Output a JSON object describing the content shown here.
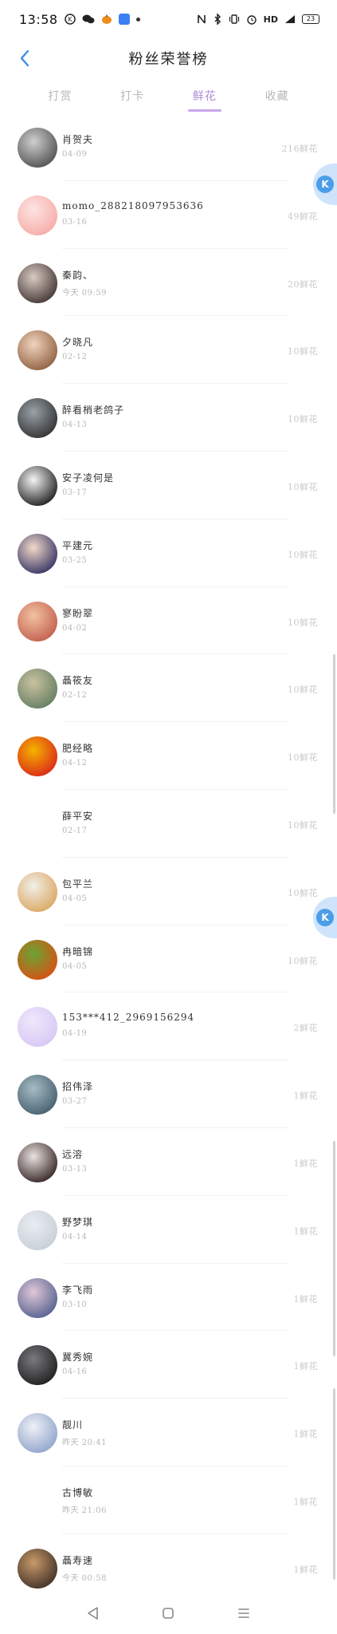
{
  "status_bar": {
    "time": "13:58",
    "battery": "23",
    "network": "HD"
  },
  "header": {
    "title": "粉丝荣誉榜",
    "back_icon": "chevron-left-icon"
  },
  "tabs": [
    {
      "label": "打赏",
      "active": false
    },
    {
      "label": "打卡",
      "active": false
    },
    {
      "label": "鲜花",
      "active": true
    },
    {
      "label": "收藏",
      "active": false
    }
  ],
  "ranking": [
    {
      "name": "肖贺夫",
      "date": "04-09",
      "value": "216鲜花",
      "avatar_colors": [
        "#4a4a4a",
        "#cfcfcf"
      ]
    },
    {
      "name": "momo_288218097953636",
      "date": "03-16",
      "value": "49鲜花",
      "avatar_colors": [
        "#f6a8a4",
        "#fde4e3"
      ]
    },
    {
      "name": "秦韵、",
      "date": "今天 09:59",
      "value": "20鲜花",
      "avatar_colors": [
        "#3a2d2a",
        "#d9cbc3"
      ]
    },
    {
      "name": "夕晓凡",
      "date": "02-12",
      "value": "10鲜花",
      "avatar_colors": [
        "#8a5a3a",
        "#f0d4bd"
      ]
    },
    {
      "name": "醉看梢老鸽子",
      "date": "04-13",
      "value": "10鲜花",
      "avatar_colors": [
        "#2b2b2b",
        "#9aa2a8"
      ]
    },
    {
      "name": "安子凌何是",
      "date": "03-17",
      "value": "10鲜花",
      "avatar_colors": [
        "#111111",
        "#f5f5f5"
      ]
    },
    {
      "name": "平建元",
      "date": "03-25",
      "value": "10鲜花",
      "avatar_colors": [
        "#2a2a5e",
        "#f2d9c8"
      ]
    },
    {
      "name": "寥盼翠",
      "date": "04-02",
      "value": "10鲜花",
      "avatar_colors": [
        "#c05a4a",
        "#f2c2a0"
      ]
    },
    {
      "name": "聶筱友",
      "date": "02-12",
      "value": "10鲜花",
      "avatar_colors": [
        "#5f7a5e",
        "#c9c2a0"
      ]
    },
    {
      "name": "肥经略",
      "date": "04-12",
      "value": "10鲜花",
      "avatar_colors": [
        "#d9201a",
        "#f5b300"
      ]
    },
    {
      "name": "薛平安",
      "date": "02-17",
      "value": "10鲜花",
      "avatar_colors": [
        "#ffffff",
        "#ffffff"
      ]
    },
    {
      "name": "包平兰",
      "date": "04-05",
      "value": "10鲜花",
      "avatar_colors": [
        "#d9a35a",
        "#f1efe8"
      ]
    },
    {
      "name": "冉暗锦",
      "date": "04-05",
      "value": "10鲜花",
      "avatar_colors": [
        "#e04b12",
        "#6aa534"
      ]
    },
    {
      "name": "153***412_2969156294",
      "date": "04-19",
      "value": "2鲜花",
      "avatar_colors": [
        "#d6c6f5",
        "#efe8fb"
      ]
    },
    {
      "name": "招伟泽",
      "date": "03-27",
      "value": "1鲜花",
      "avatar_colors": [
        "#3f5b6a",
        "#a7bcc4"
      ]
    },
    {
      "name": "远溶",
      "date": "03-13",
      "value": "1鲜花",
      "avatar_colors": [
        "#2b1a1a",
        "#e9e2e0"
      ]
    },
    {
      "name": "野梦琪",
      "date": "04-14",
      "value": "1鲜花",
      "avatar_colors": [
        "#c6cdd6",
        "#e9edf2"
      ]
    },
    {
      "name": "李飞雨",
      "date": "03-10",
      "value": "1鲜花",
      "avatar_colors": [
        "#4d5b8a",
        "#e0c8d8"
      ]
    },
    {
      "name": "冀秀婉",
      "date": "04-16",
      "value": "1鲜花",
      "avatar_colors": [
        "#1a1a1a",
        "#7a7a80"
      ]
    },
    {
      "name": "靓川",
      "date": "昨天 20:41",
      "value": "1鲜花",
      "avatar_colors": [
        "#8aa0c8",
        "#eef0f6"
      ]
    },
    {
      "name": "古博敏",
      "date": "昨天 21:06",
      "value": "1鲜花",
      "avatar_colors": [
        "#ffffff",
        "#ffffff"
      ]
    },
    {
      "name": "聶寿速",
      "date": "今天 00:58",
      "value": "1鲜花",
      "avatar_colors": [
        "#3a2a22",
        "#c79a6a"
      ]
    }
  ],
  "floating_widget_icon": "k-badge-icon",
  "bottom_nav": [
    {
      "icon": "back-triangle-icon"
    },
    {
      "icon": "home-square-icon"
    },
    {
      "icon": "menu-lines-icon"
    }
  ],
  "accent_color": "#b08ad8",
  "muted_text_color": "#c9c9c9"
}
